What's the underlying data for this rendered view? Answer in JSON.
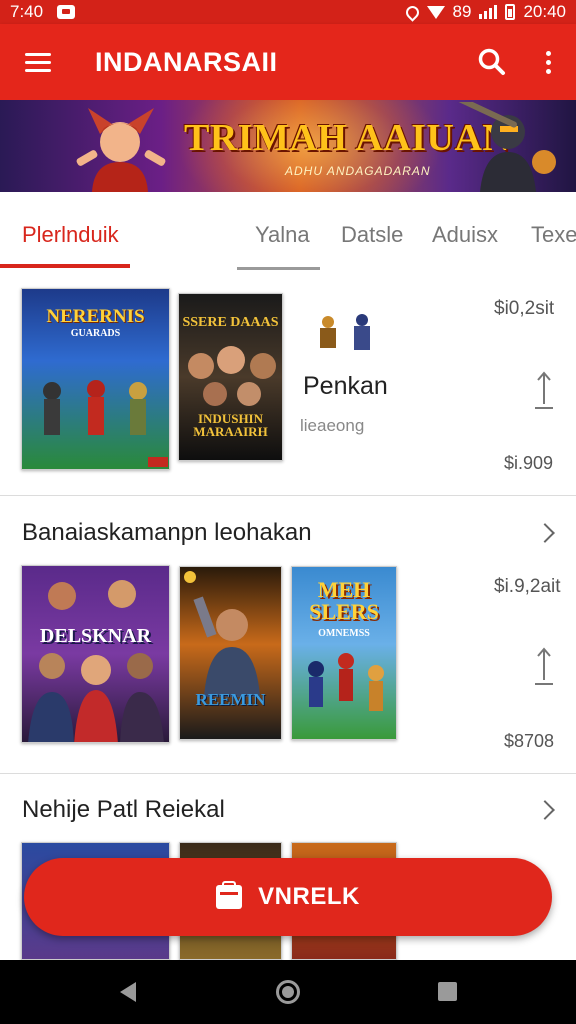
{
  "status_bar": {
    "time": "7:40",
    "signal_text": "89",
    "clock_right": "20:40"
  },
  "app_bar": {
    "menu_icon": "hamburger-menu-icon",
    "title": "INDANARSAII",
    "search_icon": "search-icon",
    "more_icon": "more-vert-icon"
  },
  "banner": {
    "title": "TRIMAH AAIUAN",
    "subtitle": "ADHU ANDAGADARAN"
  },
  "tabs": [
    {
      "label": "Plerlnduik",
      "active": true
    },
    {
      "label": "Yalna",
      "active": false
    },
    {
      "label": "Datsle",
      "active": false
    },
    {
      "label": "Aduisx",
      "active": false
    },
    {
      "label": "Texe",
      "active": false
    }
  ],
  "featured": {
    "covers": [
      {
        "title": "NERERNIS",
        "subtitle": "GUARADS"
      },
      {
        "title": "SSERE DAAAS",
        "subtitle": "INDUSHIN MARAAIRH"
      }
    ],
    "name": "Penkan",
    "subtitle": "lieaeong",
    "price_top": "$i0,2sit",
    "price_bottom": "$i.909"
  },
  "section_1": {
    "title": "Banaiaskamanpn leohakan",
    "covers": [
      {
        "title": "DELSKNAR",
        "subtitle": ""
      },
      {
        "title": "REEMIN",
        "subtitle": ""
      },
      {
        "title": "MEH SLERS",
        "subtitle": "OMNEMSS"
      }
    ],
    "price_top": "$i.9,2ait",
    "price_bottom": "$8708"
  },
  "section_2": {
    "title": "Nehije Patl Reiekal"
  },
  "fab": {
    "label": "VNRELK"
  },
  "colors": {
    "primary": "#e4261b",
    "accent_text": "#d8261c",
    "banner_title": "#ffc21a"
  }
}
